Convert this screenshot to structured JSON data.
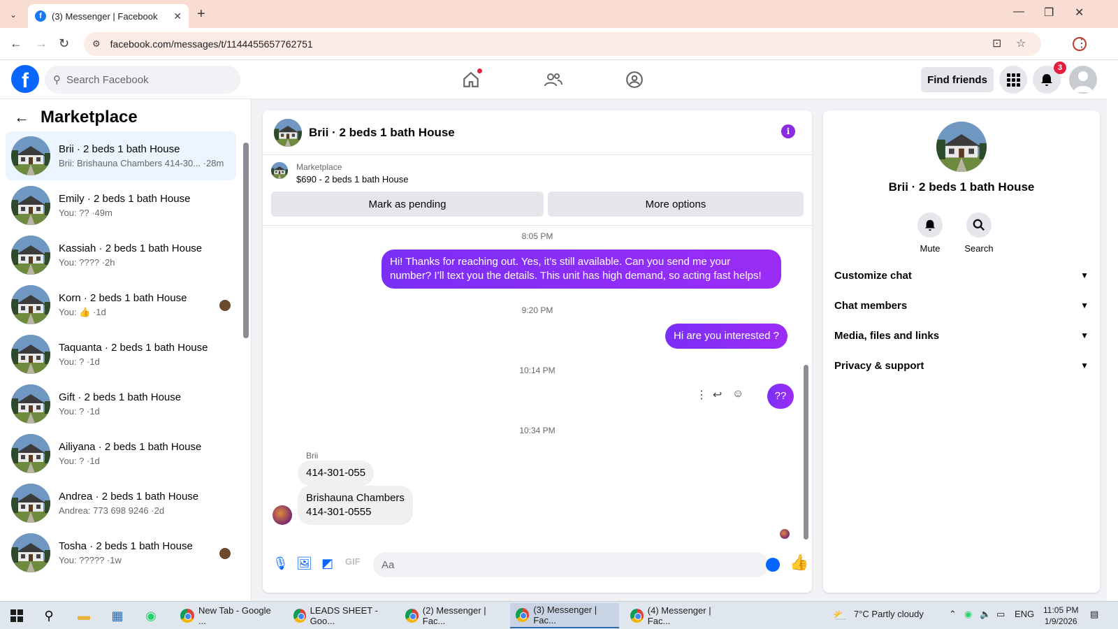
{
  "browser": {
    "tab_title": "(3) Messenger | Facebook",
    "url": "facebook.com/messages/t/1144455657762751"
  },
  "fb_header": {
    "search_placeholder": "Search Facebook",
    "find_friends": "Find friends",
    "notifications_count": "3"
  },
  "left": {
    "title": "Marketplace",
    "conversations": [
      {
        "name": "Brii · 2 beds 1 bath House",
        "sub": "Brii: Brishauna Chambers 414-30... ·28m",
        "active": true
      },
      {
        "name": "Emily · 2 beds 1 bath House",
        "sub": "You: ?? ·49m"
      },
      {
        "name": "Kassiah · 2 beds 1 bath House",
        "sub": "You: ???? ·2h"
      },
      {
        "name": "Korn · 2 beds 1 bath House",
        "sub": "You: 👍 ·1d"
      },
      {
        "name": "Taquanta · 2 beds 1 bath House",
        "sub": "You: ? ·1d"
      },
      {
        "name": "Gift · 2 beds 1 bath House",
        "sub": "You: ? ·1d"
      },
      {
        "name": "Ailiyana · 2 beds 1 bath House",
        "sub": "You: ? ·1d"
      },
      {
        "name": "Andrea · 2 beds 1 bath House",
        "sub": "Andrea: 773 698 9246 ·2d"
      },
      {
        "name": "Tosha · 2 beds 1 bath House",
        "sub": "You: ????? ·1w"
      }
    ]
  },
  "chat": {
    "title": "Brii · 2 beds 1 bath House",
    "marketplace_label": "Marketplace",
    "listing": "$690 - 2 beds 1 bath House",
    "mark_pending": "Mark as pending",
    "more_options": "More options",
    "times": [
      "8:05 PM",
      "9:20 PM",
      "10:14 PM",
      "10:34 PM"
    ],
    "msg_out_1": "Hi! Thanks for reaching out. Yes, it’s still available. Can you send me your number? I’ll text you the details. This unit has high demand, so acting fast helps!",
    "msg_out_2": "Hi are you interested ?",
    "msg_out_3": "??",
    "sender": "Brii",
    "msg_in_1": "414-301-055",
    "msg_in_2_line1": "Brishauna Chambers",
    "msg_in_2_line2": "414-301-0555",
    "composer_placeholder": "Aa"
  },
  "right": {
    "name": "Brii · 2 beds 1 bath House",
    "mute": "Mute",
    "search": "Search",
    "rows": [
      "Customize chat",
      "Chat members",
      "Media, files and links",
      "Privacy & support"
    ]
  },
  "taskbar": {
    "tasks": [
      "New Tab - Google ...",
      "LEADS SHEET - Goo...",
      "(2) Messenger | Fac...",
      "(3) Messenger | Fac...",
      "(4) Messenger | Fac..."
    ],
    "weather": "7°C  Partly cloudy",
    "lang": "ENG",
    "time": "11:05 PM",
    "date": "1/9/2026"
  },
  "colors": {
    "fb_blue": "#0866ff",
    "outgoing_bubble": "#8b2cf5",
    "active_conv": "#ebf5ff"
  }
}
